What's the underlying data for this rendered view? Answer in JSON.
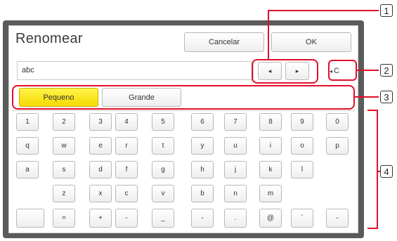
{
  "dialog": {
    "title": "Renomear",
    "cancel_label": "Cancelar",
    "ok_label": "OK",
    "input_value": "abc",
    "left_arrow": "◂",
    "right_arrow": "▸",
    "backspace_label": "C",
    "backspace_glyph": "◂"
  },
  "tabs": [
    {
      "label": "Pequeno",
      "active": true
    },
    {
      "label": "Grande",
      "active": false
    }
  ],
  "keys": {
    "row1": [
      "1",
      "2",
      "3",
      "4",
      "5",
      "6",
      "7",
      "8",
      "9",
      "0"
    ],
    "row2": [
      "q",
      "w",
      "e",
      "r",
      "t",
      "y",
      "u",
      "i",
      "o",
      "p"
    ],
    "row3": [
      "a",
      "s",
      "d",
      "f",
      "g",
      "h",
      "j",
      "k",
      "l"
    ],
    "row4": [
      "z",
      "x",
      "c",
      "v",
      "b",
      "n",
      "m"
    ],
    "row5": [
      "",
      "=",
      "+",
      "-",
      "_",
      "-",
      ".",
      "@",
      "`",
      "-"
    ]
  },
  "callouts": [
    "1",
    "2",
    "3",
    "4"
  ],
  "colors": {
    "highlight": "#e0102a",
    "active_tab": "#f5db00"
  }
}
